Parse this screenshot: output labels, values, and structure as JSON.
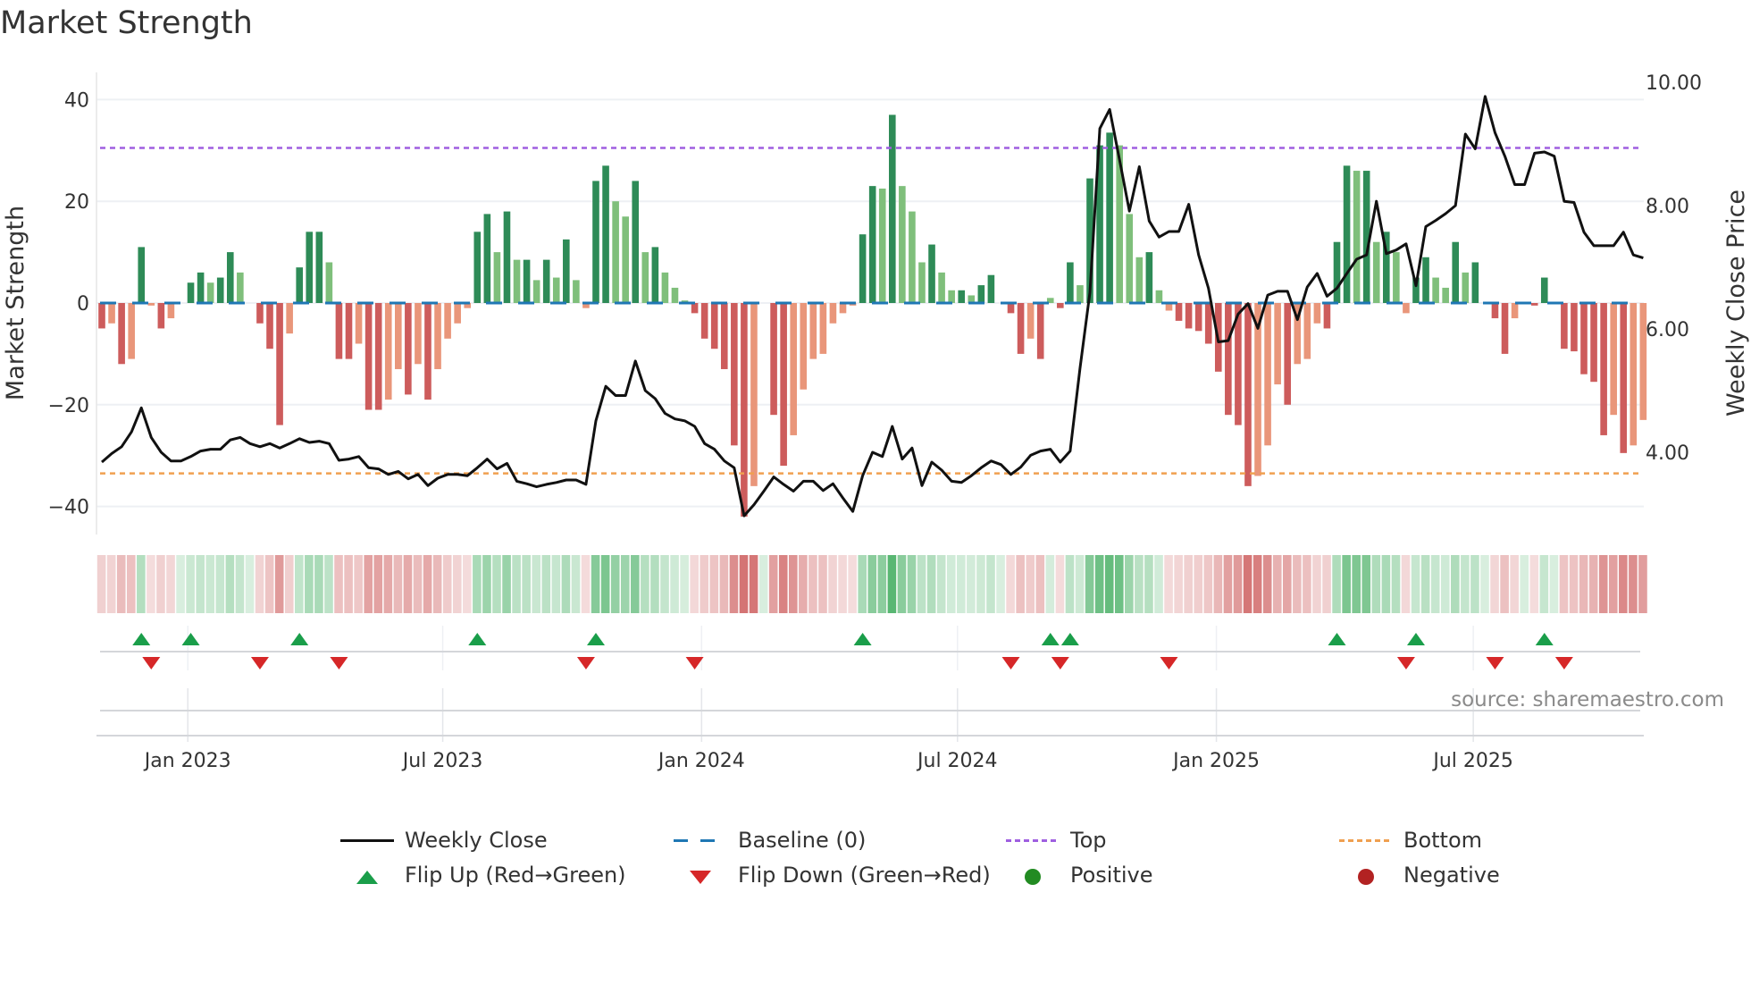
{
  "title": "Market Strength",
  "source": "source: sharemaestro.com",
  "colors": {
    "pos_dark": "#2e8b57",
    "pos_light": "#7fbf7b",
    "neg_dark": "#cd5c5c",
    "neg_light": "#e9967a",
    "baseline": "#1f77b4",
    "top": "#9f5fe0",
    "bottom": "#f0a050",
    "flip_up": "#1a9e4a",
    "flip_down": "#d62728",
    "positive": "#228b22",
    "negative": "#b22222"
  },
  "chart_data": {
    "type": "bar",
    "title": "Market Strength",
    "ylabel": "Market Strength",
    "y2label": "Weekly Close Price",
    "ylim": [
      -45,
      45
    ],
    "y2lim": [
      2.8,
      10.3
    ],
    "yticks": [
      "40",
      "20",
      "0",
      "−20",
      "−40"
    ],
    "ytick_values": [
      40,
      20,
      0,
      -20,
      -40
    ],
    "y2ticks": [
      "10.00",
      "8.00",
      "6.00",
      "4.00"
    ],
    "y2tick_values": [
      10,
      8,
      6,
      4
    ],
    "top_level": 30.5,
    "bottom_level": -33.5,
    "xticks": [
      {
        "label": "Jan 2023",
        "week": 8.7
      },
      {
        "label": "Jul 2023",
        "week": 34.5
      },
      {
        "label": "Jan 2024",
        "week": 60.7
      },
      {
        "label": "Jul 2024",
        "week": 86.6
      },
      {
        "label": "Jan 2025",
        "week": 112.8
      },
      {
        "label": "Jul 2025",
        "week": 138.8
      }
    ],
    "strength": [
      -5,
      -4,
      -12,
      -11,
      11,
      -0.5,
      -5,
      -3,
      0,
      4,
      6,
      4,
      5,
      10,
      6,
      0,
      -4,
      -9,
      -24,
      -6,
      7,
      14,
      14,
      8,
      -11,
      -11,
      -8,
      -21,
      -21,
      -19,
      -13,
      -18,
      -12,
      -19,
      -13,
      -7,
      -4,
      -1,
      14,
      17.5,
      10,
      18,
      8.5,
      8.5,
      4.5,
      8.5,
      5,
      12.5,
      4.5,
      -1,
      24,
      27,
      20,
      17,
      24,
      10,
      11,
      6,
      3,
      0.5,
      -2,
      -7,
      -9,
      -13,
      -28,
      -42,
      -36,
      0,
      -22,
      -32,
      -26,
      -17,
      -11,
      -10,
      -4,
      -2,
      -0.5,
      13.5,
      23,
      22.5,
      37,
      23,
      18,
      8,
      11.5,
      6,
      2.5,
      2.5,
      1.5,
      3.5,
      5.5,
      0,
      -2,
      -10,
      -7,
      -11,
      1,
      -1,
      8,
      3.5,
      24.5,
      31,
      33.5,
      31,
      17.5,
      9,
      10,
      2.5,
      -1.5,
      -3.5,
      -5,
      -5.5,
      -8,
      -13.5,
      -22,
      -24,
      -36,
      -34,
      -28,
      -16,
      -20,
      -12,
      -11,
      -4,
      -5,
      12,
      27,
      26,
      26,
      12,
      14,
      10,
      -2,
      5,
      9,
      5,
      3,
      12,
      6,
      8,
      0,
      -3,
      -10,
      -3,
      0,
      -0.5,
      5,
      0,
      -9,
      -9.5,
      -14,
      -15.5,
      -26,
      -22,
      -29.5,
      -28,
      -23
    ],
    "weekly_close": [
      3.84,
      3.98,
      4.09,
      4.33,
      4.72,
      4.24,
      4.0,
      3.86,
      3.86,
      3.93,
      4.02,
      4.05,
      4.05,
      4.2,
      4.24,
      4.14,
      4.09,
      4.14,
      4.07,
      4.14,
      4.22,
      4.16,
      4.18,
      4.14,
      3.87,
      3.89,
      3.93,
      3.75,
      3.73,
      3.64,
      3.69,
      3.57,
      3.64,
      3.46,
      3.58,
      3.64,
      3.64,
      3.62,
      3.75,
      3.89,
      3.73,
      3.82,
      3.53,
      3.49,
      3.44,
      3.48,
      3.51,
      3.55,
      3.55,
      3.48,
      4.51,
      5.07,
      4.92,
      4.92,
      5.48,
      5.0,
      4.87,
      4.63,
      4.54,
      4.51,
      4.42,
      4.14,
      4.05,
      3.86,
      3.75,
      2.97,
      3.15,
      3.37,
      3.6,
      3.48,
      3.37,
      3.53,
      3.53,
      3.38,
      3.49,
      3.26,
      3.04,
      3.62,
      4.0,
      3.93,
      4.42,
      3.89,
      4.07,
      3.46,
      3.84,
      3.71,
      3.53,
      3.51,
      3.62,
      3.75,
      3.86,
      3.8,
      3.64,
      3.76,
      3.95,
      4.02,
      4.05,
      3.84,
      4.02,
      5.36,
      6.59,
      9.25,
      9.56,
      8.74,
      7.91,
      8.63,
      7.75,
      7.49,
      7.58,
      7.58,
      8.02,
      7.2,
      6.66,
      5.79,
      5.81,
      6.24,
      6.41,
      6.01,
      6.55,
      6.61,
      6.61,
      6.15,
      6.68,
      6.9,
      6.53,
      6.66,
      6.9,
      7.13,
      7.2,
      8.07,
      7.22,
      7.28,
      7.38,
      6.7,
      7.66,
      7.76,
      7.87,
      8.0,
      9.16,
      8.92,
      9.77,
      9.18,
      8.8,
      8.34,
      8.34,
      8.85,
      8.87,
      8.8,
      8.07,
      8.05,
      7.57,
      7.35,
      7.35,
      7.35,
      7.57,
      7.2,
      7.15
    ],
    "flip_up_weeks": [
      4,
      9,
      20,
      38,
      50,
      77,
      96,
      98,
      125,
      133,
      146
    ],
    "flip_down_weeks": [
      5,
      16,
      24,
      49,
      60,
      92,
      97,
      108,
      132,
      141,
      148
    ],
    "legend": {
      "placement": "bottom",
      "entries": [
        "Weekly Close",
        "Baseline (0)",
        "Top",
        "Bottom",
        "Flip Up (Red→Green)",
        "Flip Down (Green→Red)",
        "Positive",
        "Negative"
      ]
    }
  }
}
